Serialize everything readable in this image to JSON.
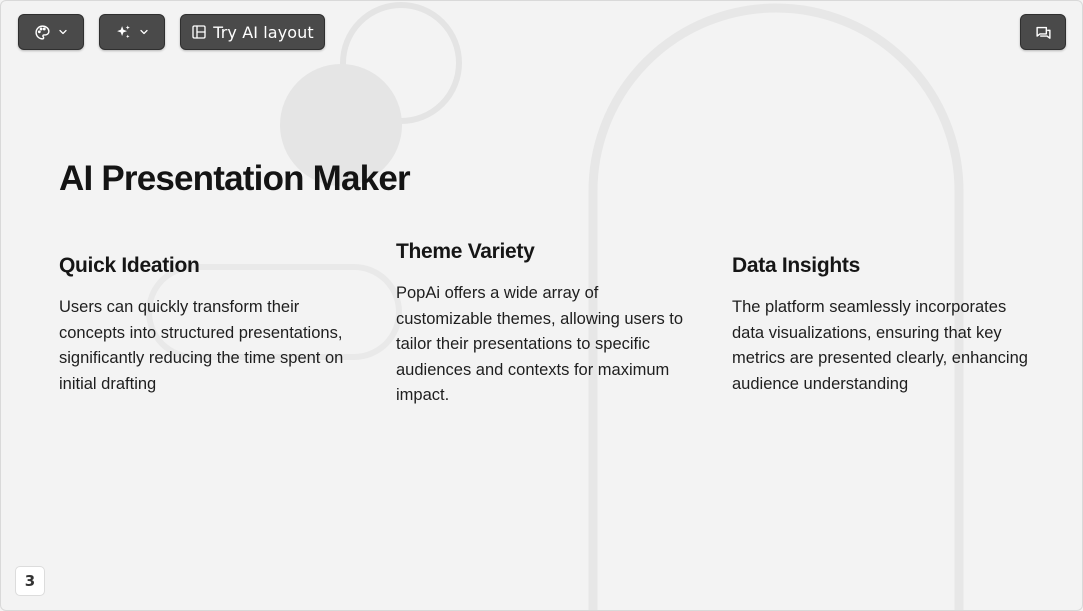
{
  "toolbar": {
    "theme_icon": "palette-icon",
    "magic_icon": "sparkle-icon",
    "ai_layout_label": "Try AI layout",
    "ai_layout_icon": "layout-icon",
    "comment_icon": "chat-icon"
  },
  "slide": {
    "title": "AI Presentation Maker",
    "columns": [
      {
        "heading": "Quick Ideation",
        "body": "Users can quickly transform their concepts into structured presentations, significantly reducing the time spent on initial drafting"
      },
      {
        "heading": "Theme Variety",
        "body": "PopAi offers a wide array of customizable themes, allowing users to tailor their presentations to specific audiences and contexts for maximum impact."
      },
      {
        "heading": "Data Insights",
        "body": "The platform seamlessly incorporates data visualizations, ensuring that key metrics are presented clearly, enhancing audience understanding"
      }
    ],
    "page_number": "3"
  },
  "colors": {
    "toolbar_button": "#4a4a4a",
    "slide_background": "#f3f3f3",
    "text": "#1d1d1d",
    "decor": "#e6e6e6"
  }
}
